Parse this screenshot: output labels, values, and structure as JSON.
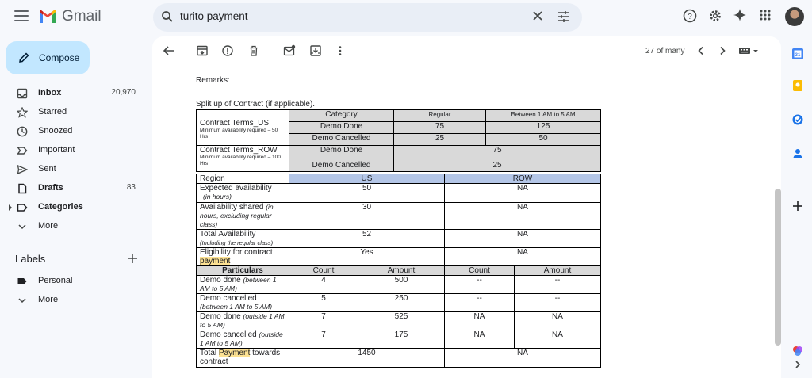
{
  "app": {
    "name": "Gmail"
  },
  "search": {
    "query": "turito payment"
  },
  "sidebar": {
    "compose": "Compose",
    "items": [
      {
        "label": "Inbox",
        "count": "20,970",
        "bold": true
      },
      {
        "label": "Starred",
        "count": ""
      },
      {
        "label": "Snoozed",
        "count": ""
      },
      {
        "label": "Important",
        "count": ""
      },
      {
        "label": "Sent",
        "count": ""
      },
      {
        "label": "Drafts",
        "count": "83",
        "bold": true
      },
      {
        "label": "Categories",
        "count": "",
        "bold": true
      },
      {
        "label": "More",
        "count": ""
      }
    ],
    "labels_heading": "Labels",
    "labels": [
      {
        "label": "Personal"
      },
      {
        "label": "More"
      }
    ]
  },
  "toolbar": {
    "pager": "27 of many"
  },
  "email": {
    "remarks": "Remarks:",
    "split_title": "Split up of Contract (if applicable).",
    "table1": {
      "col_category": "Category",
      "col_regular": "Regular",
      "col_between": "Between 1 AM to 5 AM",
      "us_label": "Contract Terms_US",
      "us_note": "Minimum availability required – 50 Hrs",
      "row_label": "Contract Terms_ROW",
      "row_note": "Minimum availability required – 100 Hrs",
      "demo_done": "Demo Done",
      "demo_cancelled": "Demo Cancelled",
      "us_done_regular": "75",
      "us_done_between": "125",
      "us_cancel_regular": "25",
      "us_cancel_between": "50",
      "row_done": "75",
      "row_cancel": "25"
    },
    "table2": {
      "region": "Region",
      "us": "US",
      "row": "ROW",
      "expected_label": "Expected availability",
      "expected_note": "(in hours)",
      "expected_us": "50",
      "expected_row": "NA",
      "shared_label": "Availability shared",
      "shared_note": "(in hours, excluding regular class)",
      "shared_us": "30",
      "shared_row": "NA",
      "total_label": "Total Availability",
      "total_note": "(Including the regular class)",
      "total_us": "52",
      "total_row": "NA",
      "elig_label": "Eligibility for contract",
      "elig_hl": "payment",
      "elig_us": "Yes",
      "elig_row": "NA",
      "particulars": "Particulars",
      "count": "Count",
      "amount": "Amount",
      "rows": [
        {
          "label": "Demo done",
          "note": "(between 1 AM to 5 AM)",
          "us_count": "4",
          "us_amount": "500",
          "row_count": "--",
          "row_amount": "--"
        },
        {
          "label": "Demo cancelled",
          "note": "(between 1 AM to 5 AM)",
          "us_count": "5",
          "us_amount": "250",
          "row_count": "--",
          "row_amount": "--"
        },
        {
          "label": "Demo done",
          "note": "(outside 1 AM to 5 AM)",
          "us_count": "7",
          "us_amount": "525",
          "row_count": "NA",
          "row_amount": "NA"
        },
        {
          "label": "Demo cancelled",
          "note": "(outside 1 AM to 5 AM)",
          "us_count": "7",
          "us_amount": "175",
          "row_count": "NA",
          "row_amount": "NA"
        }
      ],
      "total_pay_pre": "Total",
      "total_pay_hl": "Payment",
      "total_pay_post": "towards contract",
      "total_pay_us": "1450",
      "total_pay_row": "NA"
    }
  },
  "colors": {
    "compose_bg": "#c2e7ff",
    "search_bg": "#e9eef6",
    "highlight": "#fde293",
    "table_gray": "#d9d9d9",
    "table_blue": "#b4c6e7"
  },
  "icons": [
    "menu-icon",
    "gmail-logo",
    "search-icon",
    "clear-icon",
    "tune-icon",
    "help-icon",
    "settings-icon",
    "gemini-icon",
    "apps-icon",
    "avatar",
    "back-icon",
    "archive-icon",
    "report-icon",
    "delete-icon",
    "mark-unread-icon",
    "move-icon",
    "more-icon",
    "chevron-left-icon",
    "chevron-right-icon",
    "keyboard-icon",
    "calendar-icon",
    "keep-icon",
    "tasks-icon",
    "contacts-icon",
    "add-icon"
  ]
}
